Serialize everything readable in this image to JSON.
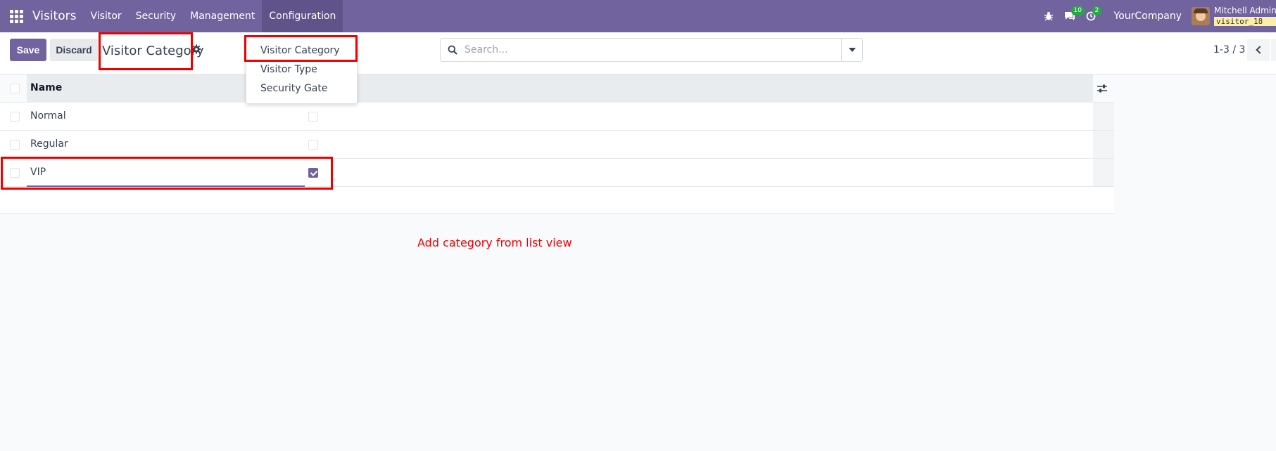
{
  "navbar": {
    "app_name": "Visitors",
    "menu": [
      "Visitor",
      "Security",
      "Management",
      "Configuration"
    ],
    "messages_count": "10",
    "activities_count": "2",
    "company": "YourCompany",
    "user_name": "Mitchell Admin",
    "database": "visitor_18"
  },
  "control_panel": {
    "save_label": "Save",
    "discard_label": "Discard",
    "title": "Visitor Category",
    "search_placeholder": "Search...",
    "pager": "1-3 / 3"
  },
  "dropdown": {
    "items": [
      "Visitor Category",
      "Visitor Type",
      "Security Gate"
    ]
  },
  "list": {
    "column_name": "Name",
    "rows": [
      {
        "name": "Normal",
        "checked": false
      },
      {
        "name": "Regular",
        "checked": false
      },
      {
        "name": "VIP",
        "checked": true
      }
    ]
  },
  "annotation": {
    "note": "Add category from list view",
    "color": "#ee0000"
  },
  "colors": {
    "brand": "#71639e",
    "badge": "#28a745"
  }
}
